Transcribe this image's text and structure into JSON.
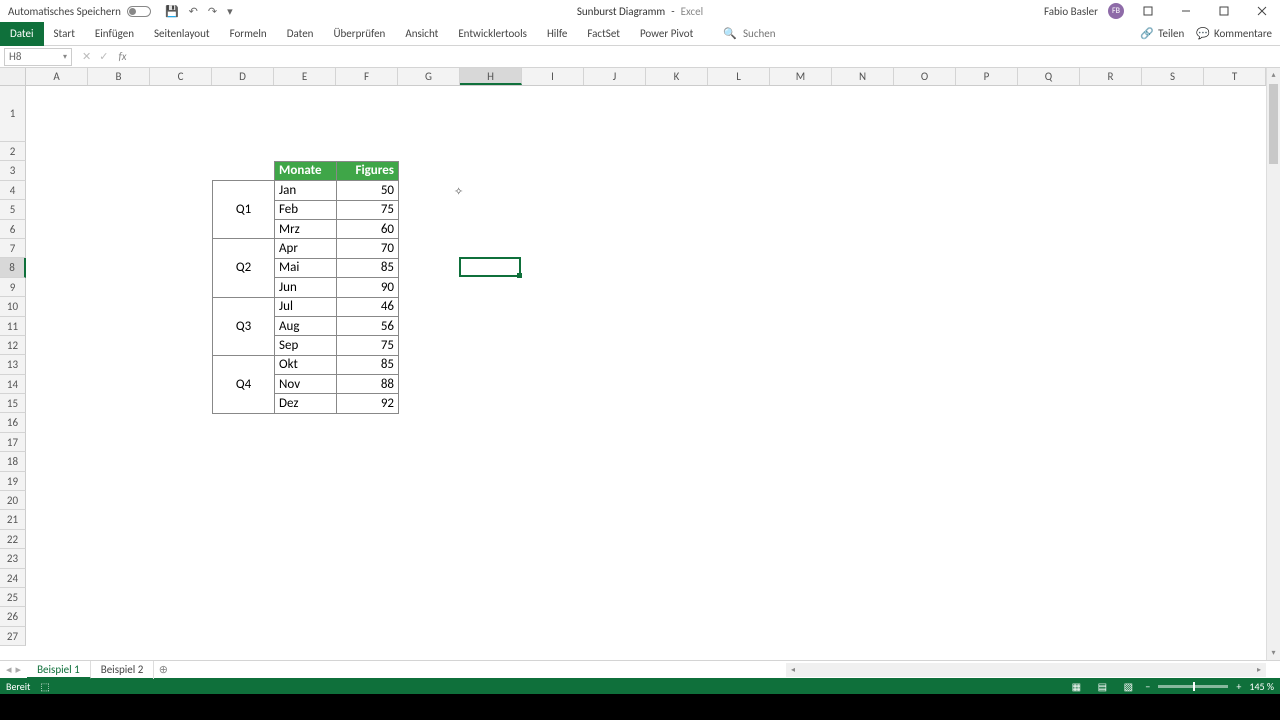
{
  "titlebar": {
    "autosave_label": "Automatisches Speichern",
    "doc_title": "Sunburst Diagramm",
    "app_name": "Excel",
    "user_name": "Fabio Basler",
    "user_initials": "FB"
  },
  "ribbon": {
    "tabs": [
      "Datei",
      "Start",
      "Einfügen",
      "Seitenlayout",
      "Formeln",
      "Daten",
      "Überprüfen",
      "Ansicht",
      "Entwicklertools",
      "Hilfe",
      "FactSet",
      "Power Pivot"
    ],
    "search_placeholder": "Suchen",
    "share": "Teilen",
    "comments": "Kommentare"
  },
  "fbar": {
    "cell_ref": "H8",
    "formula": ""
  },
  "columns": [
    "A",
    "B",
    "C",
    "D",
    "E",
    "F",
    "G",
    "H",
    "I",
    "J",
    "K",
    "L",
    "M",
    "N",
    "O",
    "P",
    "Q",
    "R",
    "S",
    "T"
  ],
  "rows": [
    "1",
    "2",
    "3",
    "4",
    "5",
    "6",
    "7",
    "8",
    "9",
    "10",
    "11",
    "12",
    "13",
    "14",
    "15",
    "16",
    "17",
    "18",
    "19",
    "20",
    "21",
    "22",
    "23",
    "24",
    "25",
    "26",
    "27"
  ],
  "selected": {
    "col": "H",
    "row": "8"
  },
  "table": {
    "headers": {
      "months": "Monate",
      "figures": "Figures"
    },
    "groups": [
      {
        "q": "Q1",
        "rows": [
          {
            "m": "Jan",
            "v": "50"
          },
          {
            "m": "Feb",
            "v": "75"
          },
          {
            "m": "Mrz",
            "v": "60"
          }
        ]
      },
      {
        "q": "Q2",
        "rows": [
          {
            "m": "Apr",
            "v": "70"
          },
          {
            "m": "Mai",
            "v": "85"
          },
          {
            "m": "Jun",
            "v": "90"
          }
        ]
      },
      {
        "q": "Q3",
        "rows": [
          {
            "m": "Jul",
            "v": "46"
          },
          {
            "m": "Aug",
            "v": "56"
          },
          {
            "m": "Sep",
            "v": "75"
          }
        ]
      },
      {
        "q": "Q4",
        "rows": [
          {
            "m": "Okt",
            "v": "85"
          },
          {
            "m": "Nov",
            "v": "88"
          },
          {
            "m": "Dez",
            "v": "92"
          }
        ]
      }
    ]
  },
  "sheets": {
    "tabs": [
      "Beispiel 1",
      "Beispiel 2"
    ],
    "active": 0
  },
  "statusbar": {
    "ready": "Bereit",
    "zoom": "145 %"
  }
}
